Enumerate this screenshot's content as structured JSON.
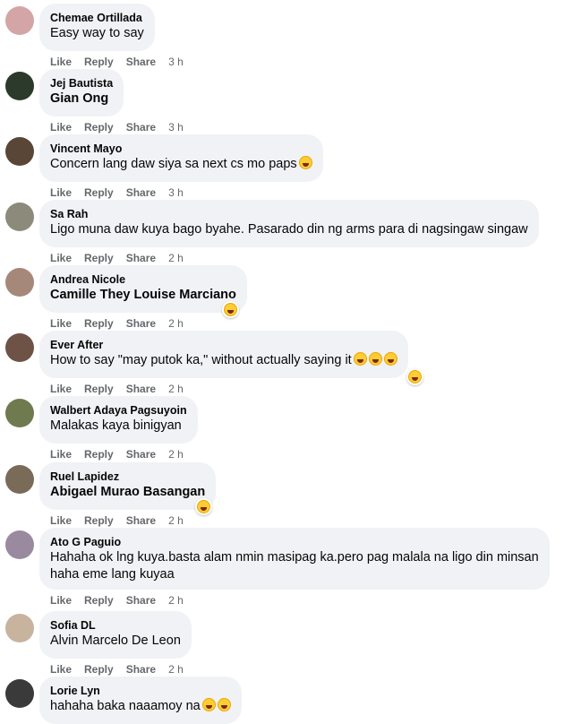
{
  "actions": {
    "like": "Like",
    "reply": "Reply",
    "share": "Share"
  },
  "comments": [
    {
      "author": "Chemae Ortillada",
      "lines": [
        "Easy way to say"
      ],
      "time": "3 h",
      "emojis": [],
      "reaction": false,
      "tag": false
    },
    {
      "author": "Jej Bautista",
      "lines": [
        "Gian Ong"
      ],
      "time": "3 h",
      "emojis": [],
      "reaction": false,
      "tag": true
    },
    {
      "author": "Vincent Mayo",
      "lines": [
        "Concern lang daw siya sa next cs mo paps"
      ],
      "time": "3 h",
      "emojis": [
        "grinning-squinting-face"
      ],
      "reaction": false,
      "tag": false
    },
    {
      "author": "Sa Rah",
      "lines": [
        "Ligo muna daw kuya bago byahe. Pasarado din ng arms para di nagsingaw singaw"
      ],
      "time": "2 h",
      "emojis": [],
      "reaction": false,
      "tag": false
    },
    {
      "author": "Andrea Nicole",
      "lines": [
        "Camille They Louise Marciano"
      ],
      "time": "2 h",
      "emojis": [],
      "reaction": true,
      "tag": true
    },
    {
      "author": "Ever After",
      "lines": [
        "How to say \"may putok ka,\" without actually saying it"
      ],
      "time": "2 h",
      "emojis": [
        "rolling-on-floor-laughing",
        "rolling-on-floor-laughing",
        "rolling-on-floor-laughing"
      ],
      "reaction": true,
      "tag": false
    },
    {
      "author": "Walbert Adaya Pagsuyoin",
      "lines": [
        "Malakas kaya binigyan"
      ],
      "time": "2 h",
      "emojis": [],
      "reaction": false,
      "tag": false
    },
    {
      "author": "Ruel Lapidez",
      "lines": [
        "Abigael Murao Basangan"
      ],
      "time": "2 h",
      "emojis": [],
      "reaction": true,
      "tag": true
    },
    {
      "author": "Ato G Paguio",
      "lines": [
        "Hahaha ok lng kuya.basta alam nmin masipag ka.pero pag malala na ligo din minsan",
        "haha eme lang kuyaa"
      ],
      "time": "2 h",
      "emojis": [],
      "reaction": false,
      "tag": false
    },
    {
      "author": "Sofia DL",
      "lines": [
        "Alvin Marcelo De Leon"
      ],
      "time": "2 h",
      "emojis": [],
      "reaction": false,
      "tag": false
    },
    {
      "author": "Lorie Lyn",
      "lines": [
        "hahaha baka naaamoy na"
      ],
      "time": "",
      "emojis": [
        "grinning-squinting-face",
        "rolling-on-floor-laughing"
      ],
      "reaction": false,
      "tag": false
    }
  ],
  "colors": {
    "bubble": "#f0f2f5",
    "meta": "#65676b",
    "text": "#050505"
  }
}
